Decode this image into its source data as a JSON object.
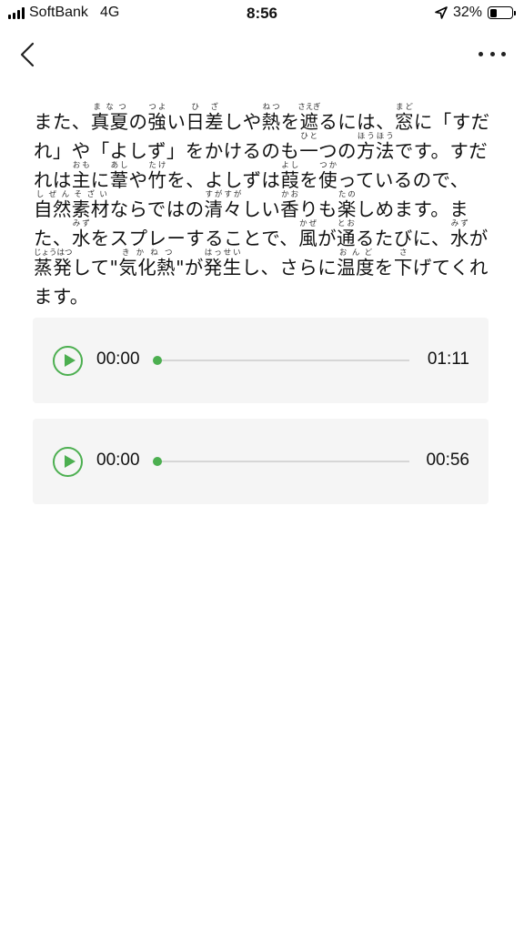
{
  "status_bar": {
    "carrier": "SoftBank",
    "network": "4G",
    "time": "8:56",
    "battery_text": "32%",
    "battery_level": 0.32
  },
  "nav": {
    "back_icon": "chevron-left-icon",
    "more_icon": "more-horizontal-icon"
  },
  "article": {
    "segments": [
      [
        "また、"
      ],
      [
        "真夏",
        "まなつ"
      ],
      [
        "の"
      ],
      [
        "強",
        "つよ"
      ],
      [
        "い"
      ],
      [
        "日差",
        "ひざ"
      ],
      [
        "しや"
      ],
      [
        "熱",
        "ねつ"
      ],
      [
        "を"
      ],
      [
        "遮",
        "さえぎ"
      ],
      [
        "るには、"
      ],
      [
        "窓",
        "まど"
      ],
      [
        "に「すだれ」や「よしず」をかけるのも"
      ],
      [
        "一",
        "ひと"
      ],
      [
        "つの"
      ],
      [
        "方法",
        "ほうほう"
      ],
      [
        "です。すだれは"
      ],
      [
        "主",
        "おも"
      ],
      [
        "に"
      ],
      [
        "葦",
        "あし"
      ],
      [
        "や"
      ],
      [
        "竹",
        "たけ"
      ],
      [
        "を、よしずは"
      ],
      [
        "葭",
        "よし"
      ],
      [
        "を"
      ],
      [
        "使",
        "つか"
      ],
      [
        "っているので、"
      ],
      [
        "自然素材",
        "しぜんそざい"
      ],
      [
        "ならではの"
      ],
      [
        "清々",
        "すがすが"
      ],
      [
        "しい"
      ],
      [
        "香",
        "かお"
      ],
      [
        "りも"
      ],
      [
        "楽",
        "たの"
      ],
      [
        "しめます。また、"
      ],
      [
        "水",
        "みず"
      ],
      [
        "をスプレーすることで、"
      ],
      [
        "風",
        "かぜ"
      ],
      [
        "が"
      ],
      [
        "通",
        "とお"
      ],
      [
        "るたびに、"
      ],
      [
        "水",
        "みず"
      ],
      [
        "が"
      ],
      [
        "蒸発",
        "じょうはつ"
      ],
      [
        "して\""
      ],
      [
        "気化熱",
        "きかねつ"
      ],
      [
        "\"が"
      ],
      [
        "発生",
        "はっせい"
      ],
      [
        "し、さらに"
      ],
      [
        "温度",
        "おんど"
      ],
      [
        "を"
      ],
      [
        "下",
        "さ"
      ],
      [
        "げてくれます。"
      ]
    ]
  },
  "players": [
    {
      "current": "00:00",
      "total": "01:11",
      "progress": 0,
      "play_icon": "play-icon"
    },
    {
      "current": "00:00",
      "total": "00:56",
      "progress": 0,
      "play_icon": "play-icon"
    }
  ],
  "colors": {
    "accent": "#4caf50",
    "player_bg": "#f5f5f5",
    "track": "#d6d6d6"
  }
}
